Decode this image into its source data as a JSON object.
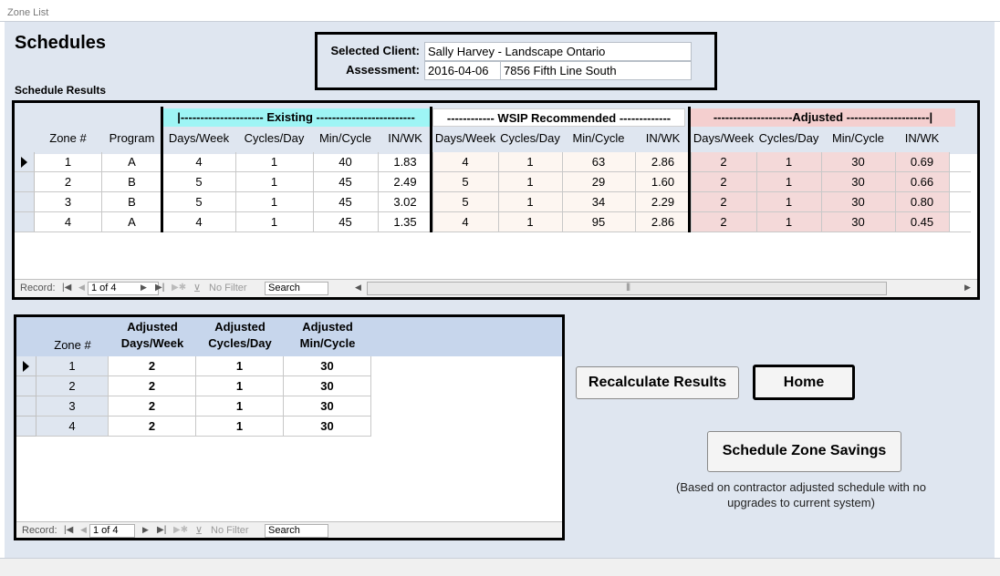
{
  "window": {
    "title": "Zone List"
  },
  "page": {
    "title": "Schedules",
    "results_label": "Schedule Results"
  },
  "client": {
    "selected_client_label": "Selected Client:",
    "selected_client_value": "Sally Harvey - Landscape Ontario",
    "assessment_label": "Assessment:",
    "assessment_date": "2016-04-06",
    "assessment_address": "7856 Fifth Line South"
  },
  "results_grid": {
    "sections": {
      "existing": "|--------------------- Existing -------------------------",
      "wsip": "------------ WSIP Recommended -------------",
      "adjusted": "--------------------Adjusted ---------------------|"
    },
    "columns": [
      "Zone #",
      "Program",
      "Days/Week",
      "Cycles/Day",
      "Min/Cycle",
      "IN/WK",
      "Days/Week",
      "Cycles/Day",
      "Min/Cycle",
      "IN/WK",
      "Days/Week",
      "Cycles/Day",
      "Min/Cycle",
      "IN/WK"
    ],
    "rows": [
      [
        "1",
        "A",
        "4",
        "1",
        "40",
        "1.83",
        "4",
        "1",
        "63",
        "2.86",
        "2",
        "1",
        "30",
        "0.69"
      ],
      [
        "2",
        "B",
        "5",
        "1",
        "45",
        "2.49",
        "5",
        "1",
        "29",
        "1.60",
        "2",
        "1",
        "30",
        "0.66"
      ],
      [
        "3",
        "B",
        "5",
        "1",
        "45",
        "3.02",
        "5",
        "1",
        "34",
        "2.29",
        "2",
        "1",
        "30",
        "0.80"
      ],
      [
        "4",
        "A",
        "4",
        "1",
        "45",
        "1.35",
        "4",
        "1",
        "95",
        "2.86",
        "2",
        "1",
        "30",
        "0.45"
      ]
    ],
    "nav": {
      "record_label": "Record:",
      "position": "1 of 4",
      "filter_label": "No Filter",
      "search_label": "Search"
    }
  },
  "adjusted_grid": {
    "columns": [
      "Zone #",
      "Adjusted\nDays/Week",
      "Adjusted\nCycles/Day",
      "Adjusted\nMin/Cycle"
    ],
    "columns_line1": [
      "",
      "Adjusted",
      "Adjusted",
      "Adjusted"
    ],
    "columns_line2": [
      "Zone #",
      "Days/Week",
      "Cycles/Day",
      "Min/Cycle"
    ],
    "rows": [
      [
        "1",
        "2",
        "1",
        "30"
      ],
      [
        "2",
        "2",
        "1",
        "30"
      ],
      [
        "3",
        "2",
        "1",
        "30"
      ],
      [
        "4",
        "2",
        "1",
        "30"
      ]
    ],
    "nav": {
      "record_label": "Record:",
      "position": "1 of 4",
      "filter_label": "No Filter",
      "search_label": "Search"
    }
  },
  "buttons": {
    "recalculate": "Recalculate Results",
    "home": "Home",
    "schedule_savings": "Schedule Zone Savings"
  },
  "note": "(Based on contractor adjusted schedule with no upgrades to current system)",
  "colors": {
    "existing_header": "#9ef5f5",
    "wsip_cells": "#fdf6f1",
    "adjusted_header": "#f4cfcf",
    "adjusted_cells": "#f4d9d9",
    "adjusted_grid_header": "#c7d6ec"
  }
}
